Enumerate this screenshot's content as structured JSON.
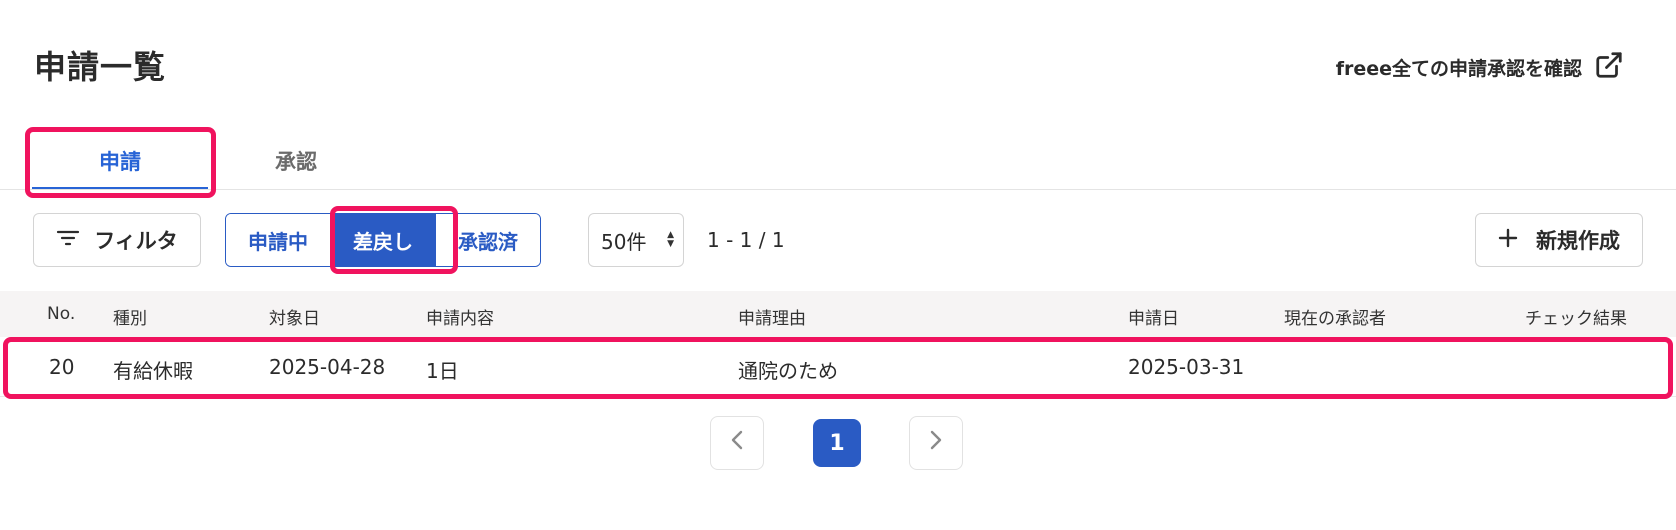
{
  "header": {
    "title": "申請一覧",
    "external_link": "freee全ての申請承認を確認"
  },
  "tabs": [
    {
      "label": "申請",
      "active": true
    },
    {
      "label": "承認",
      "active": false
    }
  ],
  "toolbar": {
    "filter_label": "フィルタ",
    "status_filters": [
      {
        "label": "申請中",
        "selected": false
      },
      {
        "label": "差戻し",
        "selected": true
      },
      {
        "label": "承認済",
        "selected": false
      }
    ],
    "page_size": "50件",
    "range": "1 - 1 / 1",
    "new_label": "新規作成"
  },
  "table": {
    "columns": [
      "No.",
      "種別",
      "対象日",
      "申請内容",
      "申請理由",
      "申請日",
      "現在の承認者",
      "チェック結果"
    ],
    "rows": [
      {
        "no": "20",
        "type": "有給休暇",
        "target_date": "2025-04-28",
        "content": "1日",
        "reason": "通院のため",
        "applied_date": "2025-03-31",
        "approver": "",
        "check": ""
      }
    ]
  },
  "pagination": {
    "current": "1"
  },
  "icons": {
    "external": "external-link-icon",
    "filter": "filter-lines-icon",
    "plus": "plus-icon",
    "prev": "chevron-left-icon",
    "next": "chevron-right-icon"
  },
  "colors": {
    "accent": "#2a5bc4",
    "tab_active": "#2864d6",
    "highlight": "#f0135e",
    "header_bg": "#f6f4f4"
  }
}
